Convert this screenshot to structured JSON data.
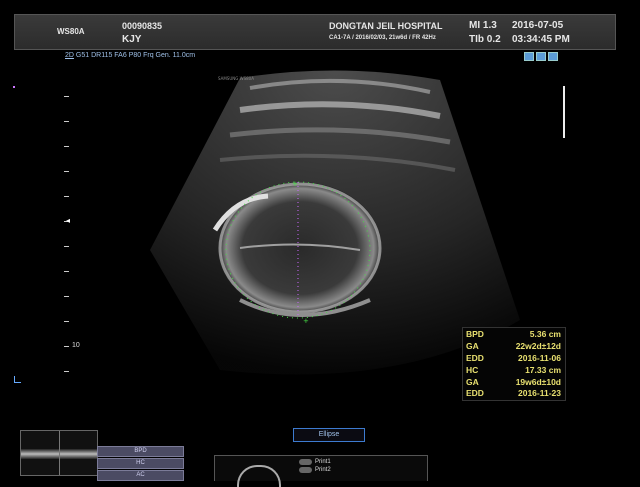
{
  "header": {
    "model": "WS80A",
    "patient_id": "00090835",
    "patient_name": "KJY",
    "hospital": "DONGTAN JEIL HOSPITAL",
    "probe_info": "CA1-7A / 2016/02/03, 21w6d / FR 42Hz",
    "mi": "MI  1.3",
    "tib": "TIb 0.2",
    "date": "2016-07-05",
    "time": "03:34:45 PM"
  },
  "imaging_params": {
    "mode": "2D",
    "settings": "G51 DR115 FA6 P80 Frq Gen. 11.0cm"
  },
  "depth_scale": {
    "marker": "10"
  },
  "image_watermark": "SAMSUNG WS80A",
  "measurements": [
    {
      "label": "BPD",
      "value": "5.36 cm"
    },
    {
      "label": "GA",
      "value": "22w2d±12d"
    },
    {
      "label": "EDD",
      "value": "2016-11-06"
    },
    {
      "label": "HC",
      "value": "17.33 cm"
    },
    {
      "label": "GA",
      "value": "19w6d±10d"
    },
    {
      "label": "EDD",
      "value": "2016-11-23"
    }
  ],
  "measure_menu": [
    "BPD",
    "HC",
    "AC"
  ],
  "tool_button": "Ellipse",
  "print_buttons": [
    "Print1",
    "Print2"
  ],
  "colors": {
    "background": "#000000",
    "header_bg": "#333333",
    "measurement_text": "#e8e070",
    "accent_blue": "#3d7bd0",
    "caliper_green": "#44dd44",
    "caliper_purple": "#cc66ff"
  }
}
